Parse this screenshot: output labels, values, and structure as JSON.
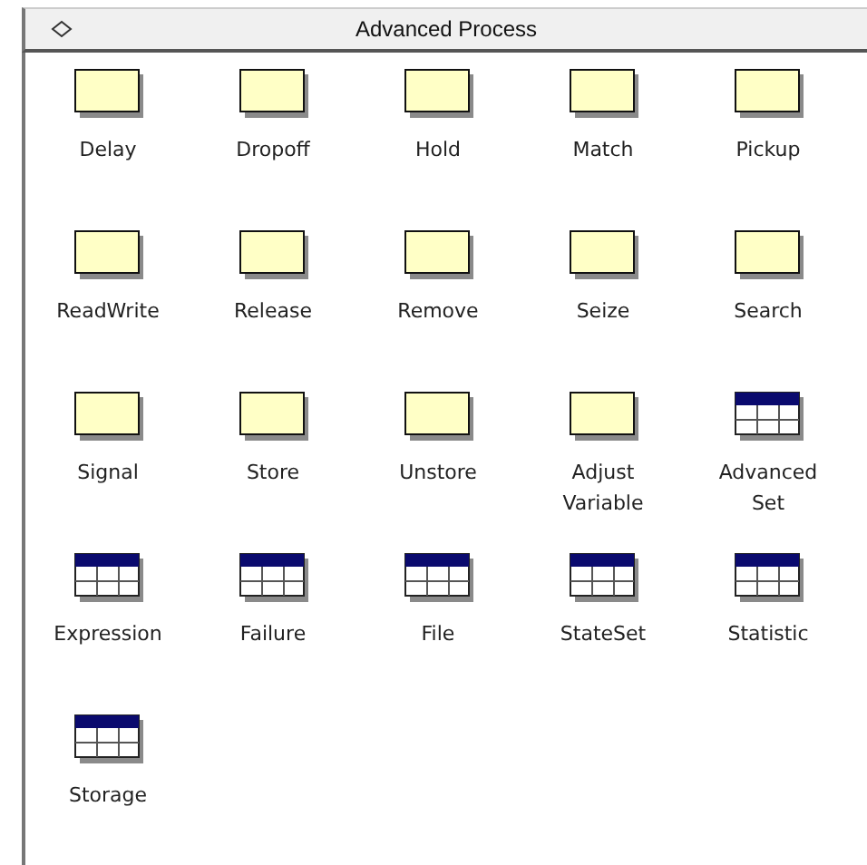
{
  "panel": {
    "title": "Advanced Process"
  },
  "items": [
    {
      "label": "Delay",
      "kind": "module"
    },
    {
      "label": "Dropoff",
      "kind": "module"
    },
    {
      "label": "Hold",
      "kind": "module"
    },
    {
      "label": "Match",
      "kind": "module"
    },
    {
      "label": "Pickup",
      "kind": "module"
    },
    {
      "label": "ReadWrite",
      "kind": "module"
    },
    {
      "label": "Release",
      "kind": "module"
    },
    {
      "label": "Remove",
      "kind": "module"
    },
    {
      "label": "Seize",
      "kind": "module"
    },
    {
      "label": "Search",
      "kind": "module"
    },
    {
      "label": "Signal",
      "kind": "module"
    },
    {
      "label": "Store",
      "kind": "module"
    },
    {
      "label": "Unstore",
      "kind": "module"
    },
    {
      "label": "Adjust\nVariable",
      "kind": "module"
    },
    {
      "label": "Advanced\nSet",
      "kind": "data"
    },
    {
      "label": "Expression",
      "kind": "data"
    },
    {
      "label": "Failure",
      "kind": "data"
    },
    {
      "label": "File",
      "kind": "data"
    },
    {
      "label": "StateSet",
      "kind": "data"
    },
    {
      "label": "Statistic",
      "kind": "data"
    },
    {
      "label": "Storage",
      "kind": "data"
    }
  ]
}
